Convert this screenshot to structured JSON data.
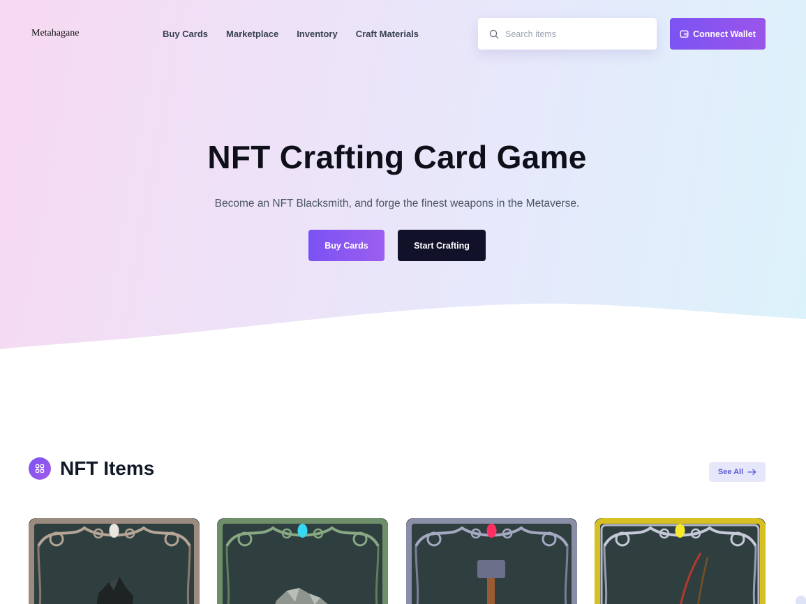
{
  "header": {
    "logo": "Metahagane",
    "nav": [
      "Buy Cards",
      "Marketplace",
      "Inventory",
      "Craft Materials"
    ],
    "search_placeholder": "Search items",
    "connect_wallet_label": "Connect Wallet",
    "search_icon": "search-icon",
    "wallet_icon": "wallet-icon"
  },
  "hero": {
    "title": "NFT Crafting Card Game",
    "subtitle": "Become an NFT Blacksmith, and forge the finest weapons in the Metaverse.",
    "buy_cards_label": "Buy Cards",
    "start_crafting_label": "Start Crafting"
  },
  "nft_section": {
    "title": "NFT Items",
    "icon": "grid-icon",
    "see_all_label": "See All",
    "see_all_icon": "arrow-right-icon",
    "cards": [
      {
        "frame": "#9b8a7e",
        "gem": "#e9e6e0",
        "item": "dark-ore-chunk"
      },
      {
        "frame": "#6f8f6a",
        "gem": "#36d7f2",
        "item": "silver-ore-chunk"
      },
      {
        "frame": "#8a8ea6",
        "gem": "#ff2f62",
        "item": "hammer"
      },
      {
        "frame": "#d6c022",
        "gem": "#f8ea2a",
        "item": "bow"
      }
    ]
  },
  "colors": {
    "accent": "#7c53f3",
    "accent_alt": "#9a55ea",
    "dark_button": "#11122a",
    "card_bg": "#2f3f40"
  }
}
